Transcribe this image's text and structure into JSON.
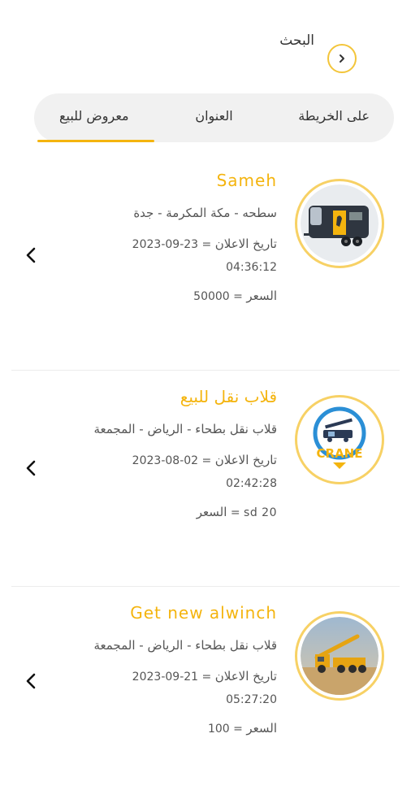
{
  "header": {
    "title": "البحث"
  },
  "tabs": [
    {
      "label": "على الخريطة"
    },
    {
      "label": "العنوان"
    },
    {
      "label": "معروض للبيع"
    }
  ],
  "ads": [
    {
      "name": "Sameh",
      "location": "سطحه - مكة المكرمة - جدة",
      "date_label": "تاريخ الاعلان",
      "date": "23-09-2023",
      "time": "04:36:12",
      "price_label": "السعر",
      "price": "50000"
    },
    {
      "name": "قلاب نقل للبيع",
      "location": "قلاب نقل بطحاء - الرياض - المجمعة",
      "date_label": "تاريخ الاعلان",
      "date": "02-08-2023",
      "time": "02:42:28",
      "price_label": "السعر",
      "price": "sd 20"
    },
    {
      "name": "Get new alwinch",
      "location": "قلاب نقل بطحاء - الرياض - المجمعة",
      "date_label": "تاريخ الاعلان",
      "date": "21-09-2023",
      "time": "05:27:20",
      "price_label": "السعر",
      "price": "100"
    }
  ],
  "logo_text": "CRANE",
  "colors": {
    "accent": "#f4b40e",
    "ring": "#f7d165",
    "tab_bg": "#f1f1f1"
  }
}
